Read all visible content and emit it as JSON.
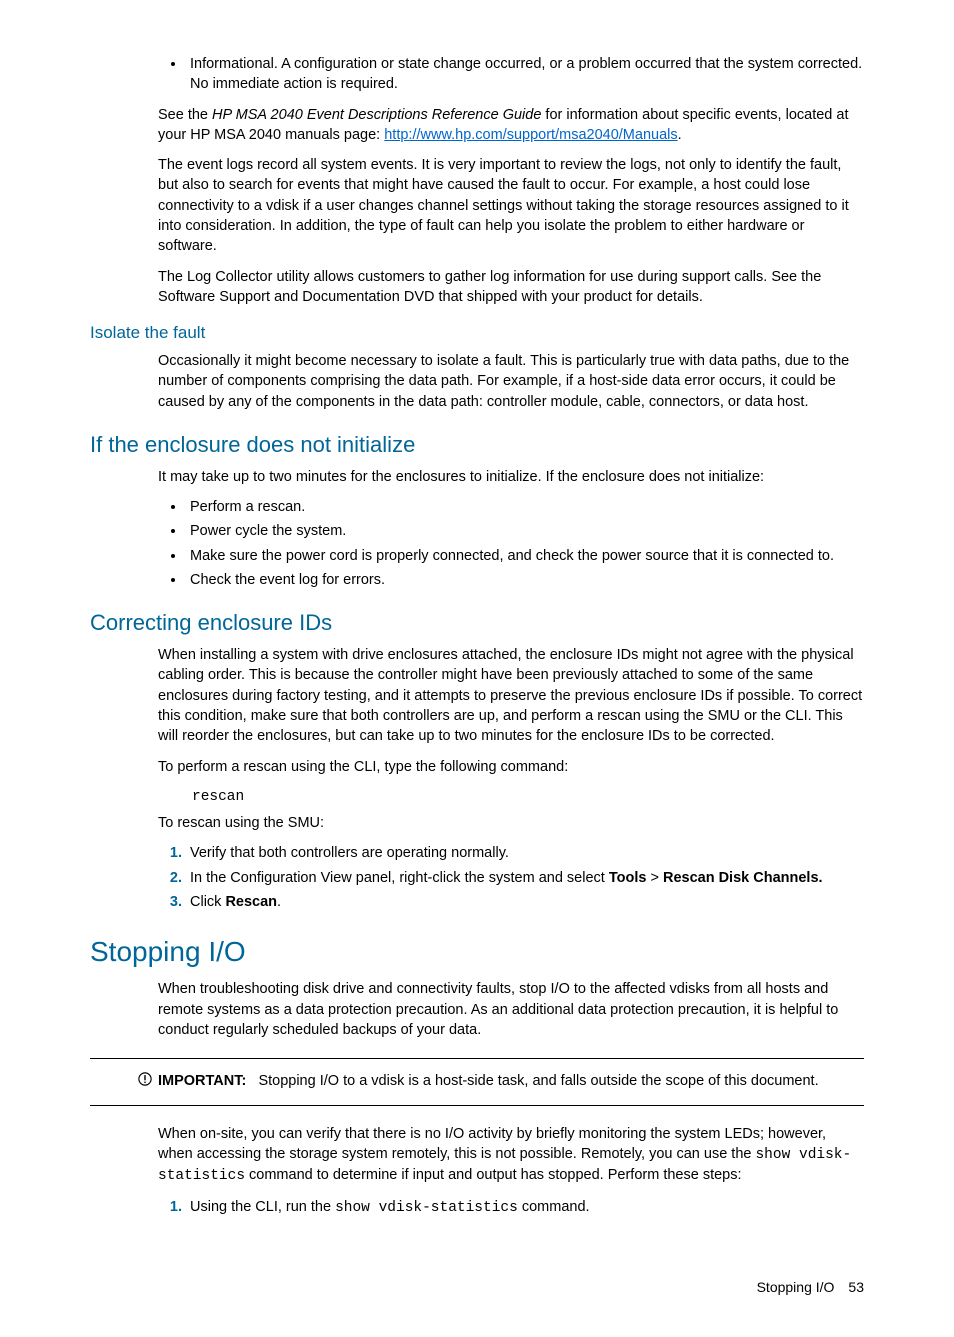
{
  "intro": {
    "bullet1": "Informational. A configuration or state change occurred, or a problem occurred that the system corrected. No immediate action is required.",
    "see_prefix": "See the ",
    "see_italic": "HP MSA 2040 Event Descriptions Reference Guide",
    "see_mid": " for information about specific events, located at your HP MSA 2040 manuals page: ",
    "see_link": "http://www.hp.com/support/msa2040/Manuals",
    "see_suffix": ".",
    "p2": "The event logs record all system events. It is very important to review the logs, not only to identify the fault, but also to search for events that might have caused the fault to occur. For example, a host could lose connectivity to a vdisk if a user changes channel settings without taking the storage resources assigned to it into consideration. In addition, the type of fault can help you isolate the problem to either hardware or software.",
    "p3": "The Log Collector utility allows customers to gather log information for use during support calls. See the Software Support and Documentation DVD that shipped with your product for details."
  },
  "isolate": {
    "heading": "Isolate the fault",
    "p1": "Occasionally it might become necessary to isolate a fault. This is particularly true with data paths, due to the number of components comprising the data path. For example, if a host-side data error occurs, it could be caused by any of the components in the data path: controller module, cable, connectors, or data host."
  },
  "initialize": {
    "heading": "If the enclosure does not initialize",
    "p1": "It may take up to two minutes for the enclosures to initialize. If the enclosure does not initialize:",
    "b1": "Perform a rescan.",
    "b2": "Power cycle the system.",
    "b3": "Make sure the power cord is properly connected, and check the power source that it is connected to.",
    "b4": "Check the event log for errors."
  },
  "correcting": {
    "heading": "Correcting enclosure IDs",
    "p1": "When installing a system with drive enclosures attached, the enclosure IDs might not agree with the physical cabling order. This is because the controller might have been previously attached to some of the same enclosures during factory testing, and it attempts to preserve the previous enclosure IDs if possible. To correct this condition, make sure that both controllers are up, and perform a rescan using the SMU or the CLI. This will reorder the enclosures, but can take up to two minutes for the enclosure IDs to be corrected.",
    "p2": "To perform a rescan using the CLI, type the following command:",
    "code": "rescan",
    "p3": "To rescan using the SMU:",
    "s1": "Verify that both controllers are operating normally.",
    "s2_a": "In the Configuration View panel, right-click the system and select ",
    "s2_tools": "Tools",
    "s2_gt": " > ",
    "s2_rescan": "Rescan Disk Channels.",
    "s3_a": "Click ",
    "s3_b": "Rescan",
    "s3_c": "."
  },
  "stopping": {
    "heading": "Stopping I/O",
    "p1": "When troubleshooting disk drive and connectivity faults, stop I/O to the affected vdisks from all hosts and remote systems as a data protection precaution. As an additional data protection precaution, it is helpful to conduct regularly scheduled backups of your data.",
    "important_label": "IMPORTANT:",
    "important_text": "Stopping I/O to a vdisk is a host-side task, and falls outside the scope of this document.",
    "p2_a": "When on-site, you can verify that there is no I/O activity by briefly monitoring the system LEDs; however, when accessing the storage system remotely, this is not possible. Remotely, you can use the ",
    "p2_code1": "show vdisk-statistics",
    "p2_b": " command to determine if input and output has stopped. Perform these steps:",
    "s1_a": "Using the CLI, run the ",
    "s1_code": "show vdisk-statistics",
    "s1_b": " command."
  },
  "footer": {
    "title": "Stopping I/O",
    "page": "53"
  }
}
